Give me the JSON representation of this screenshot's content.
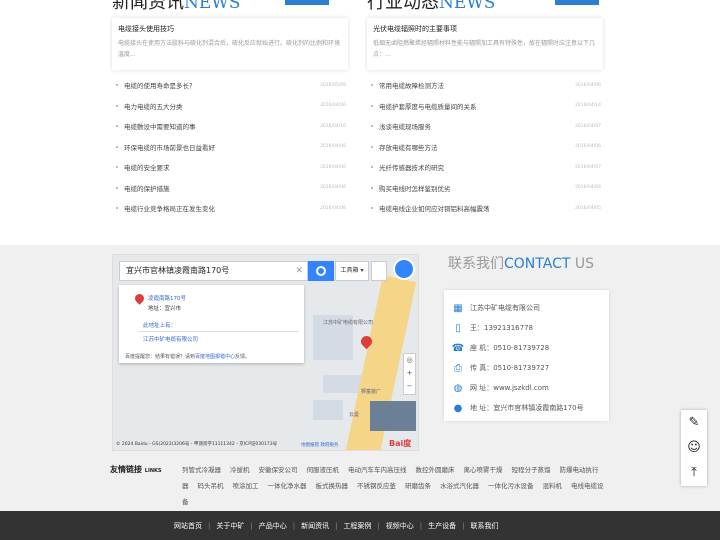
{
  "news": {
    "title_cn": "新闻资讯",
    "title_en": "NEWS",
    "feature": {
      "title": "电缆接头使用技巧",
      "text": "电缆接头在使用方法胶料与硫化剂混合后，硫化反应就始进行。硫化剂的比例和环境温度..."
    },
    "items": [
      {
        "title": "电缆的使用寿命是多长？",
        "date": "2016/05/09"
      },
      {
        "title": "电力电缆的五大分类",
        "date": "2016/04/06"
      },
      {
        "title": "电缆敷设中需要知道的事",
        "date": "2016/04/10"
      },
      {
        "title": "环保电缆的市场前景也日益看好",
        "date": "2016/04/06"
      },
      {
        "title": "电缆的安全要求",
        "date": "2016/04/06"
      },
      {
        "title": "电缆的保护措施",
        "date": "2016/04/06"
      },
      {
        "title": "电缆行业竞争格局正在发生变化",
        "date": "2016/04/06"
      }
    ]
  },
  "industry": {
    "title_cn": "行业动态",
    "title_en": "NEWS",
    "feature": {
      "title": "光伏电缆辐照时的主要事项",
      "text": "低烟无卤阻燃聚烯烃辐照材料性能与辐照加工具有特殊性，故在辐照时应注意以下几点：..."
    },
    "items": [
      {
        "title": "常用电缆故障检测方法",
        "date": "2016/04/06"
      },
      {
        "title": "电缆护套厚度与电缆质量间的关系",
        "date": "2016/04/14"
      },
      {
        "title": "浅谈电缆现场服务",
        "date": "2016/04/07"
      },
      {
        "title": "存放电缆有哪些方法",
        "date": "2016/04/06"
      },
      {
        "title": "光纤传感器技术的研究",
        "date": "2016/04/07"
      },
      {
        "title": "购买电线时怎样鉴别优劣",
        "date": "2016/04/06"
      },
      {
        "title": "电缆电线企业如何应对铜铝料高幅震荡",
        "date": "2016/04/05"
      }
    ]
  },
  "map": {
    "search_value": "宜兴市官林镇凌霞南路170号",
    "tools_label": "工具箱",
    "popup_name": "凌霞南路170号",
    "popup_address": "地址：宜兴市",
    "popup_nearby": "此地址上有：",
    "popup_company": "江苏中矿电缆有限公司",
    "popup_footer": "百度提醒您：结果有错误？请到",
    "popup_footer_link": "百度地图报错中心",
    "popup_footer_tail": "反馈。",
    "label_factory": "江苏中矿电缆有限公司",
    "label_site1": "狮童装厂",
    "label_site2": "云曼",
    "copyright": "© 2024 Baidu - GS(2023)3206号 - 甲测资字11111342 - 京ICP证030173号",
    "link_error": "地图报错",
    "link_gov": "政府服务",
    "brand": "Bai度"
  },
  "contact": {
    "title_cn": "联系我们",
    "title_en": "CONTACT",
    "title_en2": "US",
    "company": "江苏中矿电缆有限公司",
    "mobile": "王：13921316778",
    "tel": "座 机：0510-81739728",
    "fax": "传 真：0510-81739727",
    "web": "网 址：www.jszkdl.com",
    "address": "地 址：宜兴市官林镇凌霞南路170号"
  },
  "links": {
    "head_cn": "友情链接",
    "head_en": "LINKS",
    "items": [
      "列管式冷凝器",
      "冷拔机",
      "安徽保安公司",
      "伺服液压机",
      "电动汽车车内高压线",
      "数控外圆磨床",
      "离心喷雾干燥",
      "短程分子蒸馏",
      "防爆电动执行器",
      "码头吊机",
      "喷涂加工",
      "一体化净水器",
      "板式换热器",
      "不锈钢反应釜",
      "研磨齿条",
      "水浴式汽化器",
      "一体化污水设备",
      "混料机",
      "电线电缆设备"
    ]
  },
  "footer": {
    "nav": [
      "网站首页",
      "关于中矿",
      "产品中心",
      "新闻资讯",
      "工程案例",
      "视频中心",
      "生产设备",
      "联系我们"
    ]
  }
}
